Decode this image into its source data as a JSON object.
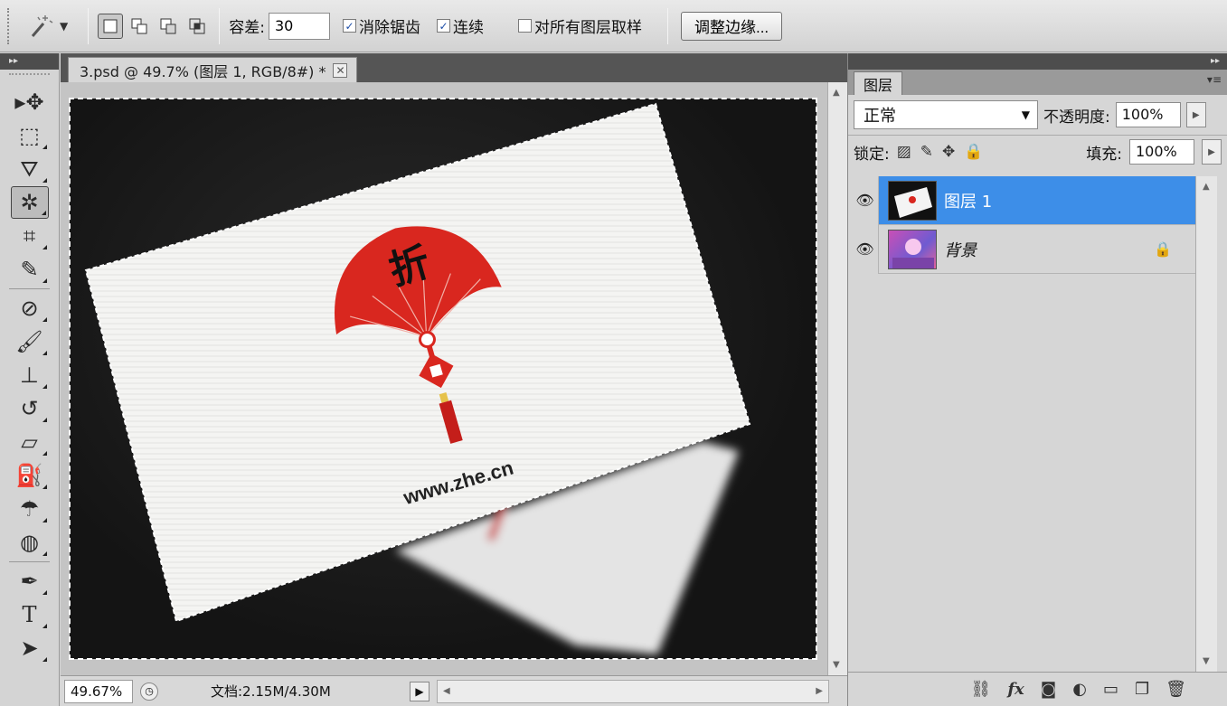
{
  "options_bar": {
    "tool_icon": "magic-wand-icon",
    "selection_modes": [
      "new-selection",
      "add-to-selection",
      "subtract-from-selection",
      "intersect-selection"
    ],
    "tolerance_label": "容差:",
    "tolerance_value": "30",
    "anti_alias": {
      "label": "消除锯齿",
      "checked": true
    },
    "contiguous": {
      "label": "连续",
      "checked": true
    },
    "sample_all_layers": {
      "label": "对所有图层取样",
      "checked": false
    },
    "refine_edge_label": "调整边缘..."
  },
  "toolbox": {
    "active_tool": "magic-wand"
  },
  "document": {
    "tab_title": "3.psd @ 49.7% (图层 1, RGB/8#) *",
    "close_glyph": "✕",
    "card_url": "www.zhe.cn",
    "fan_char": "折",
    "status_zoom": "49.67%",
    "status_info": "文档:2.15M/4.30M"
  },
  "layers_panel": {
    "tab_label": "图层",
    "blend_mode": "正常",
    "opacity_label": "不透明度:",
    "opacity_value": "100%",
    "lock_label": "锁定:",
    "fill_label": "填充:",
    "fill_value": "100%",
    "layers": [
      {
        "name": "图层 1",
        "selected": true,
        "locked": false
      },
      {
        "name": "背景",
        "selected": false,
        "locked": true
      }
    ]
  },
  "colors": {
    "selected_layer": "#3d8ee8",
    "fan_red": "#d9271f",
    "canvas_dark": "#1c1c1c"
  }
}
